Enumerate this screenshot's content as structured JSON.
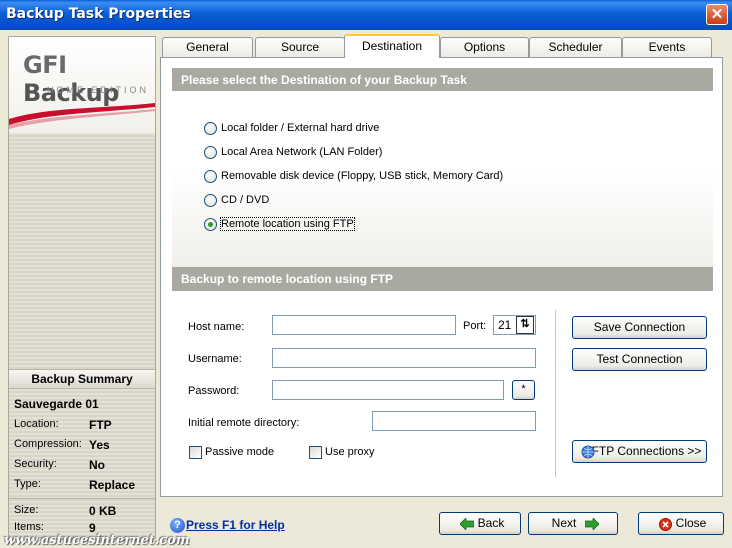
{
  "window": {
    "title": "Backup Task Properties",
    "close_glyph": "✕"
  },
  "logo": {
    "brand_gfi": "GFI",
    "brand_backup": "Backup",
    "edition": "HOME EDITION"
  },
  "summary": {
    "header": "Backup Summary",
    "task_name": "Sauvegarde 01",
    "rows": [
      {
        "key": "Location:",
        "value": "FTP"
      },
      {
        "key": "Compression:",
        "value": "Yes"
      },
      {
        "key": "Security:",
        "value": "No"
      },
      {
        "key": "Type:",
        "value": "Replace"
      },
      {
        "key": "Size:",
        "value": "0 KB"
      },
      {
        "key": "Items:",
        "value": "9"
      }
    ]
  },
  "tabs": [
    "General",
    "Source",
    "Destination",
    "Options",
    "Scheduler",
    "Events"
  ],
  "active_tab": "Destination",
  "destination": {
    "header": "Please select the Destination of your Backup Task",
    "options": [
      "Local folder / External hard drive",
      "Local Area Network (LAN Folder)",
      "Removable disk device (Floppy, USB stick, Memory Card)",
      "CD / DVD",
      "Remote location using FTP"
    ],
    "selected": "Remote location using FTP"
  },
  "ftp": {
    "header": "Backup to remote location using FTP",
    "host_label": "Host name:",
    "host_value": "",
    "port_label": "Port:",
    "port_value": "21",
    "username_label": "Username:",
    "username_value": "",
    "password_label": "Password:",
    "password_value": "",
    "password_button": "*",
    "remote_dir_label": "Initial remote directory:",
    "remote_dir_value": "",
    "passive_label": "Passive mode",
    "passive_checked": false,
    "proxy_label": "Use proxy",
    "proxy_checked": false,
    "save_connection": "Save Connection",
    "test_connection": "Test Connection",
    "ftp_connections": "FTP Connections >>"
  },
  "footer": {
    "help": "Press F1 for Help",
    "help_glyph": "?",
    "back": "Back",
    "next": "Next",
    "close": "Close",
    "watermark": "www.astucesinternet.com"
  },
  "colors": {
    "title_bar": "#0a5fd6",
    "section_header": "#aaa9a1",
    "close_red": "#cf3a14",
    "arrow_green": "#2f9e2f"
  }
}
